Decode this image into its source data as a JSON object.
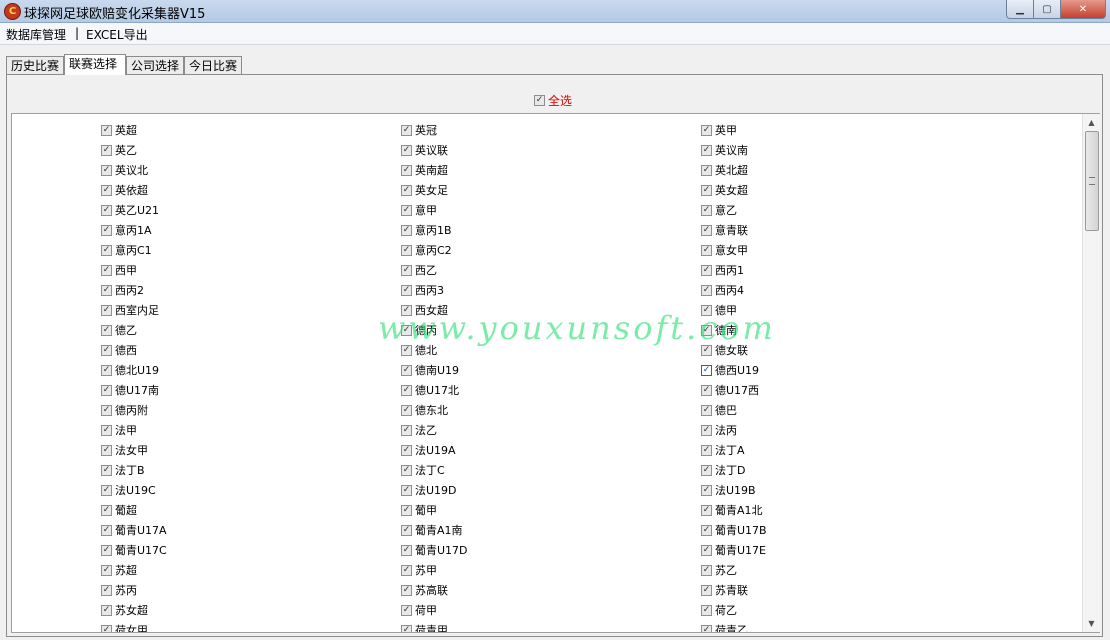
{
  "window": {
    "title": "球探网足球欧赔变化采集器V15",
    "icon_name": "app-logo-icon"
  },
  "menubar": {
    "items": [
      "数据库管理",
      "EXCEL导出"
    ],
    "separator": "|"
  },
  "tabs": [
    {
      "label": "历史比赛",
      "active": false
    },
    {
      "label": "联赛选择",
      "active": true
    },
    {
      "label": "公司选择",
      "active": false
    },
    {
      "label": "今日比赛",
      "active": false
    }
  ],
  "select_all": {
    "label": "全选",
    "checked": true,
    "color": "#e00000"
  },
  "leagues": [
    [
      "英超",
      "英冠",
      "英甲"
    ],
    [
      "英乙",
      "英议联",
      "英议南"
    ],
    [
      "英议北",
      "英南超",
      "英北超"
    ],
    [
      "英依超",
      "英女足",
      "英女超"
    ],
    [
      "英乙U21",
      "意甲",
      "意乙"
    ],
    [
      "意丙1A",
      "意丙1B",
      "意青联"
    ],
    [
      "意丙C1",
      "意丙C2",
      "意女甲"
    ],
    [
      "西甲",
      "西乙",
      "西丙1"
    ],
    [
      "西丙2",
      "西丙3",
      "西丙4"
    ],
    [
      "西室内足",
      "西女超",
      "德甲"
    ],
    [
      "德乙",
      "德丙",
      "德南"
    ],
    [
      "德西",
      "德北",
      "德女联"
    ],
    [
      "德北U19",
      "德南U19",
      "德西U19"
    ],
    [
      "德U17南",
      "德U17北",
      "德U17西"
    ],
    [
      "德丙附",
      "德东北",
      "德巴"
    ],
    [
      "法甲",
      "法乙",
      "法丙"
    ],
    [
      "法女甲",
      "法U19A",
      "法丁A"
    ],
    [
      "法丁B",
      "法丁C",
      "法丁D"
    ],
    [
      "法U19C",
      "法U19D",
      "法U19B"
    ],
    [
      "葡超",
      "葡甲",
      "葡青A1北"
    ],
    [
      "葡青U17A",
      "葡青A1南",
      "葡青U17B"
    ],
    [
      "葡青U17C",
      "葡青U17D",
      "葡青U17E"
    ],
    [
      "苏超",
      "苏甲",
      "苏乙"
    ],
    [
      "苏丙",
      "苏高联",
      "苏青联"
    ],
    [
      "苏女超",
      "荷甲",
      "荷乙"
    ],
    [
      "荷女甲",
      "荷青甲",
      "荷青乙"
    ]
  ],
  "highlighted_item": "德西U19",
  "watermark": "www.youxunsoft.com",
  "colors": {
    "title_bar": "#b4c9e4",
    "check_blue": "#1a4fa3",
    "accent_red": "#e00000"
  }
}
